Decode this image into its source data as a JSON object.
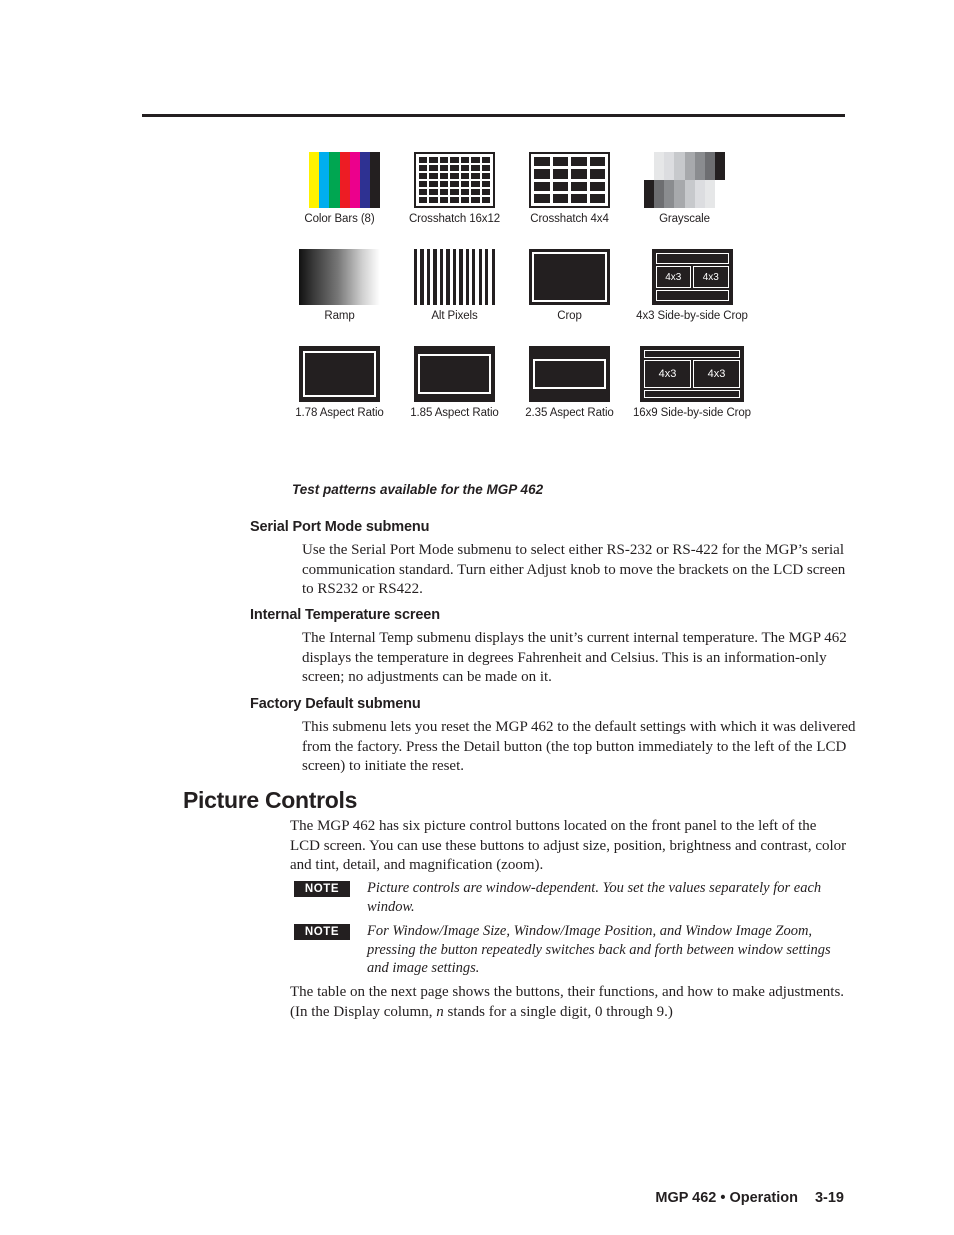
{
  "page": {
    "footer_title": "MGP 462 • Operation",
    "page_number": "3-19"
  },
  "figure": {
    "caption": "Test patterns available for the MGP 462",
    "patterns": [
      {
        "label": "Color Bars (8)",
        "type": "color-bars"
      },
      {
        "label": "Crosshatch 16x12",
        "type": "crosshatch-16x12"
      },
      {
        "label": "Crosshatch 4x4",
        "type": "crosshatch-4x4"
      },
      {
        "label": "Grayscale",
        "type": "grayscale"
      },
      {
        "label": "Ramp",
        "type": "ramp"
      },
      {
        "label": "Alt Pixels",
        "type": "alt-pixels"
      },
      {
        "label": "Crop",
        "type": "crop"
      },
      {
        "label": "4x3 Side-by-side Crop",
        "type": "side-by-side-4x3"
      },
      {
        "label": "1.78 Aspect Ratio",
        "type": "aspect-1.78"
      },
      {
        "label": "1.85 Aspect Ratio",
        "type": "aspect-1.85"
      },
      {
        "label": "2.35 Aspect Ratio",
        "type": "aspect-2.35"
      },
      {
        "label": "16x9 Side-by-side Crop",
        "type": "side-by-side-16x9"
      }
    ],
    "pane_label_left": "4x3",
    "pane_label_right": "4x3",
    "color_bars": [
      "#ffffff",
      "#fff200",
      "#00aeef",
      "#00a651",
      "#ed1c24",
      "#ec008c",
      "#2e3192",
      "#231f20"
    ],
    "grayscale_top": [
      "#ffffff",
      "#e6e7e8",
      "#dcdde0",
      "#c7c9cc",
      "#a7a9ac",
      "#8a8c8f",
      "#6d6e71",
      "#231f20"
    ],
    "grayscale_bottom": [
      "#231f20",
      "#6d6e71",
      "#8a8c8f",
      "#a7a9ac",
      "#c7c9cc",
      "#dcdde0",
      "#e6e7e8",
      "#ffffff"
    ]
  },
  "sections": {
    "serial": {
      "heading": "Serial Port Mode submenu",
      "body": "Use the Serial Port Mode submenu to select either RS-232 or RS-422 for the MGP’s serial communication standard.  Turn either Adjust knob to move the brackets on the LCD screen to RS232 or RS422."
    },
    "temperature": {
      "heading": "Internal Temperature screen",
      "body": "The Internal Temp submenu displays the unit’s current internal temperature.  The MGP 462 displays the temperature in degrees Fahrenheit and Celsius.  This is an information-only screen; no adjustments can be made on it."
    },
    "factory": {
      "heading": "Factory Default submenu",
      "body": "This submenu lets you reset the MGP 462 to the default settings with which it was delivered from the factory.  Press the Detail button (the top button immediately to the left of the LCD screen) to initiate the reset."
    }
  },
  "picture_controls": {
    "heading": "Picture Controls",
    "intro": "The MGP 462 has six picture control buttons located on the front panel to the left of the LCD screen.  You can use these buttons to adjust size, position, brightness and contrast, color and tint, detail, and magnification (zoom).",
    "note_tag": "NOTE",
    "note_1": "Picture controls are window-dependent.  You set the values separately for each window.",
    "note_2": "For Window/Image Size, Window/Image Position, and Window Image Zoom, pressing the button repeatedly switches back and forth between window settings and image settings.",
    "table_note_before": "The table on the next page shows the buttons, their functions, and how to make adjustments.  (In the Display column, ",
    "table_note_italic": "n",
    "table_note_after": " stands for a single digit, 0 through 9.)"
  }
}
